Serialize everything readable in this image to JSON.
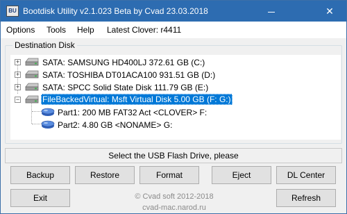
{
  "window": {
    "title": "Bootdisk Utility v2.1.023 Beta by Cvad 23.03.2018",
    "icon_text": "BU",
    "close_glyph": "✕"
  },
  "menu": {
    "options": "Options",
    "tools": "Tools",
    "help": "Help",
    "latest_clover": "Latest Clover: r4411"
  },
  "destination": {
    "label": "Destination Disk",
    "disks": [
      {
        "label": "SATA: SAMSUNG HD400LJ 372.61 GB (C:)",
        "expanded": false
      },
      {
        "label": "SATA: TOSHIBA DT01ACA100 931.51 GB (D:)",
        "expanded": false
      },
      {
        "label": "SATA: SPCC Solid State Disk 111.79 GB (E:)",
        "expanded": false
      },
      {
        "label": "FileBackedVirtual: Msft Virtual Disk 5.00 GB (F: G:)",
        "expanded": true,
        "selected": true,
        "partitions": [
          {
            "label": "Part1: 200 MB FAT32 Act <CLOVER> F:"
          },
          {
            "label": "Part2: 4.80 GB <NONAME> G:"
          }
        ]
      }
    ],
    "expander_plus": "+",
    "expander_minus": "−"
  },
  "status": "Select the USB Flash Drive, please",
  "buttons": {
    "backup": "Backup",
    "restore": "Restore",
    "format": "Format",
    "eject": "Eject",
    "dl_center": "DL Center",
    "exit": "Exit",
    "refresh": "Refresh"
  },
  "footer": {
    "copyright": "© Cvad soft 2012-2018",
    "url": "cvad-mac.narod.ru"
  },
  "colors": {
    "titlebar": "#2d6cb1",
    "selection": "#0078d7"
  }
}
